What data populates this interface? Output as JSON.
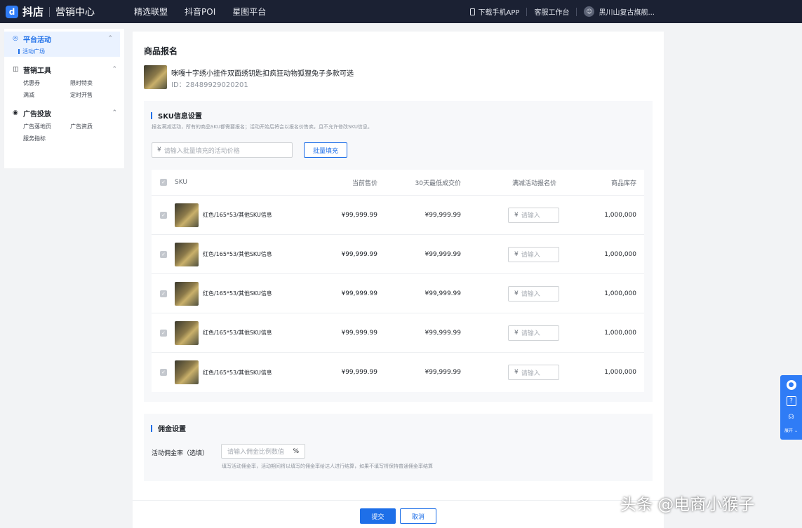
{
  "topbar": {
    "logo_mark": "d",
    "logo_text": "抖店",
    "logo_sub": "营销中心",
    "nav": [
      "精选联盟",
      "抖音POI",
      "星图平台"
    ],
    "download_app": "下载手机APP",
    "service_desk": "客服工作台",
    "shop_name": "黑川山复古旗舰..."
  },
  "sidebar": {
    "groups": [
      {
        "label": "平台活动",
        "items": [
          "活动广场"
        ]
      },
      {
        "label": "营销工具",
        "items": [
          "优惠券",
          "限时特卖",
          "满减",
          "定时开售"
        ]
      },
      {
        "label": "广告投放",
        "items": [
          "广告落地页",
          "广告资质",
          "服务指标"
        ]
      }
    ]
  },
  "main": {
    "title": "商品报名",
    "product": {
      "name": "咪嘎十字绣小挂件双面绣钥匙扣疯狂动物狐狸兔子多款可选",
      "id": "ID：28489929020201"
    },
    "sku_section": {
      "title": "SKU信息设置",
      "desc": "报名满减活动，所有的商品SKU都需要报名；活动开始后将会以报名价售卖，且不允许修改SKU信息。",
      "batch_placeholder": "请输入批量填充的活动价格",
      "currency": "¥",
      "batch_button": "批量填充",
      "columns": [
        "SKU",
        "当前售价",
        "30天最低成交价",
        "满减活动报名价",
        "商品库存"
      ],
      "row_placeholder": "请输入",
      "rows": [
        {
          "sku": "红色/165*53/其他SKU信息",
          "price": "¥99,999.99",
          "low": "¥99,999.99",
          "stock": "1,000,000"
        },
        {
          "sku": "红色/165*53/其他SKU信息",
          "price": "¥99,999.99",
          "low": "¥99,999.99",
          "stock": "1,000,000"
        },
        {
          "sku": "红色/165*53/其他SKU信息",
          "price": "¥99,999.99",
          "low": "¥99,999.99",
          "stock": "1,000,000"
        },
        {
          "sku": "红色/165*53/其他SKU信息",
          "price": "¥99,999.99",
          "low": "¥99,999.99",
          "stock": "1,000,000"
        },
        {
          "sku": "红色/165*53/其他SKU信息",
          "price": "¥99,999.99",
          "low": "¥99,999.99",
          "stock": "1,000,000"
        }
      ]
    },
    "commission": {
      "title": "佣金设置",
      "label": "活动佣金率（选填）",
      "placeholder": "请输入佣金比例数值",
      "unit": "%",
      "note": "填写活动佣金率，活动期间将以填写的佣金率给达人进行结算，如果不填写将保持普通佣金率结算"
    },
    "submit": "提交",
    "cancel": "取消"
  },
  "float_tool": {
    "collapse": "展开"
  },
  "watermark": "头条 @电商小猴子",
  "colors": {
    "accent": "#1e6fe8",
    "topbar": "#1b2133",
    "page_bg": "#f2f3f5"
  }
}
